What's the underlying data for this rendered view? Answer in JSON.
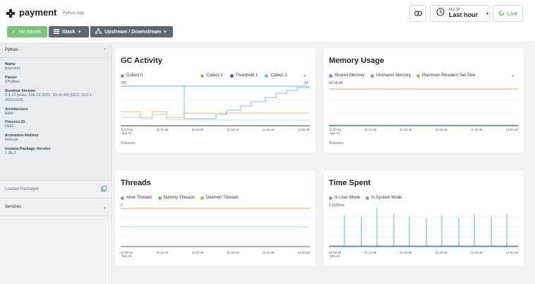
{
  "app": {
    "title": "payment",
    "subtitle": "Python App",
    "link_icon": "link-icon",
    "time": {
      "date": "Mar 04",
      "range": "Last hour"
    },
    "live": "Live",
    "colors": {
      "green": "#7dc47a",
      "gray": "#5d6770",
      "live_green": "#3aa655"
    }
  },
  "toolbar": {
    "no_issues": "No Issues",
    "stack": "Stack",
    "upstream": "Upstream / Downstream"
  },
  "sidebar": {
    "section": "Python",
    "properties": [
      {
        "key": "Name",
        "value": "payment"
      },
      {
        "key": "Flavor",
        "value": "CPython"
      },
      {
        "key": "Runtime Version",
        "value": "3.9.10 (main, Feb 25 2022, 23:10:28) [GCC 10.2.1 20210110]"
      },
      {
        "key": "Architecture",
        "value": "64bit"
      },
      {
        "key": "Process ID",
        "value": "5616"
      },
      {
        "key": "Activation Method",
        "value": "Manual"
      },
      {
        "key": "Instana Package Version",
        "value": "1.36.2"
      }
    ],
    "loaded_packages": "Loaded Packages",
    "services": "Services"
  },
  "x_ticks": [
    "11:02:46",
    "11:12:46",
    "11:22:46",
    "11:32:46",
    "11:42:46",
    "11:52:46"
  ],
  "x_tick_sub": "Mar 04",
  "releases": "Releases",
  "cards": {
    "gc": {
      "title": "GC Activity",
      "legend": [
        {
          "label": "Collect 0",
          "color": "#5aa9dd"
        },
        {
          "label": "Collect 1",
          "color": "#f0a04b"
        },
        {
          "label": "Threshold 1",
          "color": "#3b5dab"
        },
        {
          "label": "Collect 2",
          "color": "#5ec5d6"
        }
      ],
      "y_left_max": "700",
      "y_right_max": "34"
    },
    "memory": {
      "title": "Memory Usage",
      "legend": [
        {
          "label": "Shared Memory",
          "color": "#5aa9dd"
        },
        {
          "label": "Unshared Memory",
          "color": "#6bbf6e"
        },
        {
          "label": "Maximum Resident Set Size",
          "color": "#f0a04b"
        }
      ],
      "y_max": "42.08 kB"
    },
    "threads": {
      "title": "Threads",
      "legend": [
        {
          "label": "Alive Threads",
          "color": "#5aa9dd"
        },
        {
          "label": "Dummy Threads",
          "color": "#6bbf6e"
        },
        {
          "label": "Daemon Threads",
          "color": "#f0a04b"
        }
      ],
      "y_max": "2"
    },
    "time": {
      "title": "Time Spent",
      "legend": [
        {
          "label": "In User Mode",
          "color": "#5aa9dd"
        },
        {
          "label": "In System Mode",
          "color": "#6bbf6e"
        }
      ],
      "y_max": "0.1600ms"
    }
  }
}
